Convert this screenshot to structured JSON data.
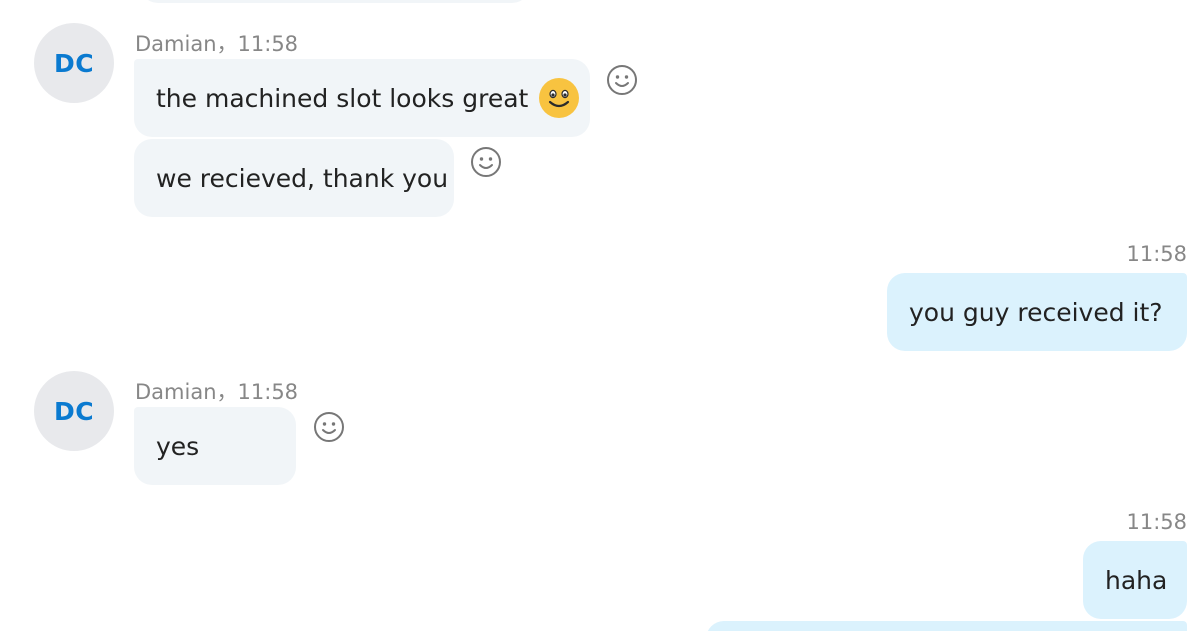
{
  "messages": [
    {
      "sender_initials": "DC",
      "sender_name": "Damian",
      "time": "11:58",
      "bubbles": [
        {
          "text": "the machined slot looks great",
          "emoji": "smile-emoji"
        },
        {
          "text": "we recieved, thank you"
        }
      ]
    },
    {
      "time": "11:58",
      "bubbles": [
        {
          "text": "you guy received it?"
        }
      ]
    },
    {
      "sender_initials": "DC",
      "sender_name": "Damian",
      "time": "11:58",
      "bubbles": [
        {
          "text": "yes"
        }
      ]
    },
    {
      "time": "11:58",
      "bubbles": [
        {
          "text": "haha"
        }
      ]
    }
  ],
  "separator": "，",
  "icons": {
    "reaction": "add-reaction-icon",
    "emoji": "smile-emoji"
  },
  "colors": {
    "incoming_bubble": "#f1f5f8",
    "outgoing_bubble": "#dbf2fd",
    "avatar_text": "#0a7ad0",
    "avatar_bg": "#e8e9ec",
    "meta_text": "#878787"
  }
}
